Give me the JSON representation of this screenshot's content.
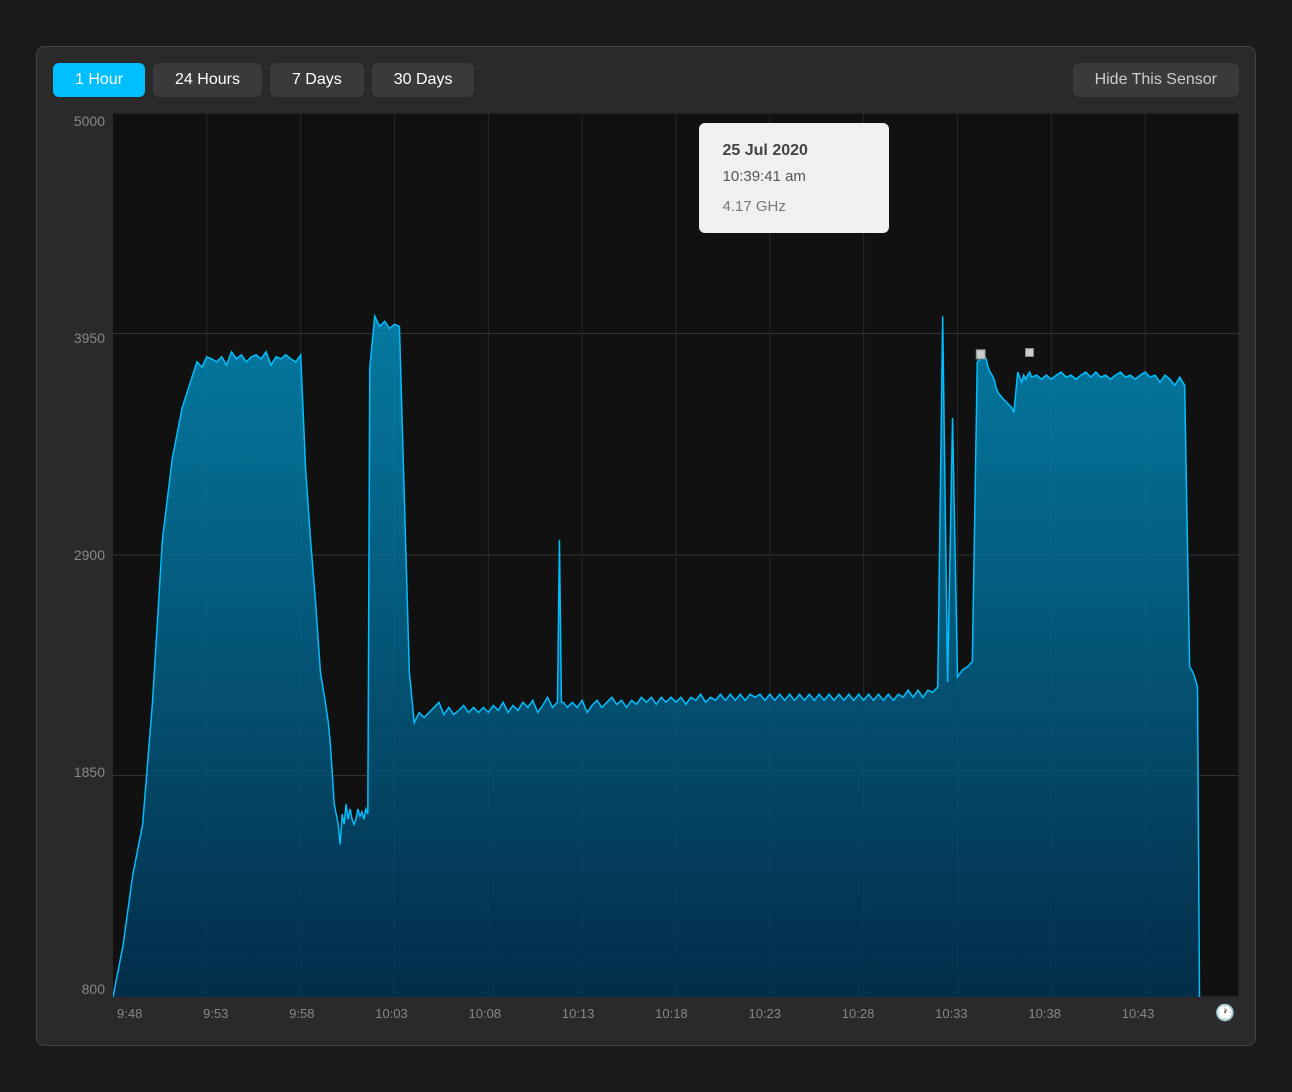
{
  "toolbar": {
    "buttons": [
      {
        "label": "1 Hour",
        "active": true,
        "id": "1hour"
      },
      {
        "label": "24 Hours",
        "active": false,
        "id": "24hours"
      },
      {
        "label": "7 Days",
        "active": false,
        "id": "7days"
      },
      {
        "label": "30 Days",
        "active": false,
        "id": "30days"
      }
    ],
    "hide_sensor_label": "Hide This Sensor"
  },
  "y_axis": {
    "labels": [
      "5000",
      "3950",
      "2900",
      "1850",
      "800"
    ]
  },
  "x_axis": {
    "labels": [
      "9:48",
      "9:53",
      "9:58",
      "10:03",
      "10:08",
      "10:13",
      "10:18",
      "10:23",
      "10:28",
      "10:33",
      "10:38",
      "10:43"
    ]
  },
  "tooltip": {
    "date": "25 Jul 2020",
    "time": "10:39:41 am",
    "value": "4.17 GHz"
  },
  "chart": {
    "bg_color": "#111",
    "line_color": "#00aaee",
    "fill_color": "#005580"
  }
}
